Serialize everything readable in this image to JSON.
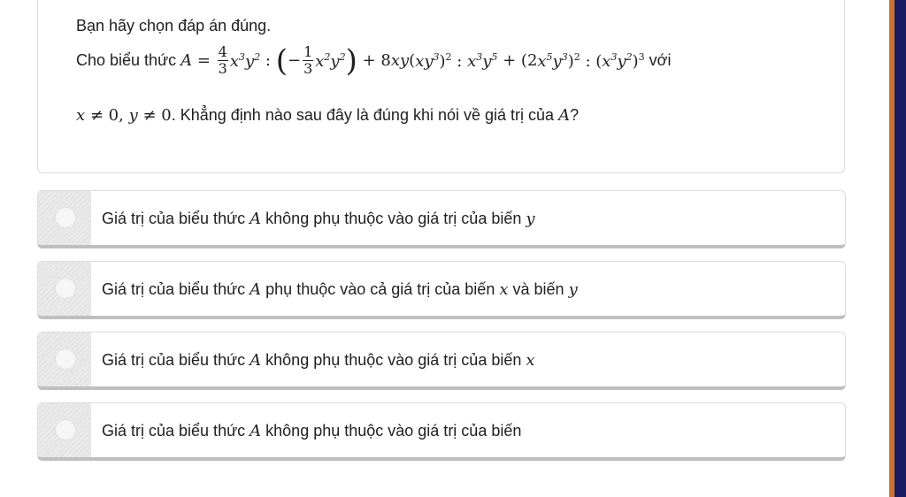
{
  "question": {
    "instruction": "Bạn hãy chọn đáp án đúng.",
    "intro": "Cho biểu thức",
    "suffix": "với",
    "condition_text": ". Khẳng định nào sau đây là đúng khi nói về giá trị của",
    "question_end": "?"
  },
  "options": [
    {
      "text_before": "Giá trị của biểu thức",
      "text_after": "không phụ thuộc vào giá trị của biến",
      "var": "y"
    },
    {
      "text_before": "Giá trị của biểu thức",
      "text_after": "phụ thuộc vào cả giá trị của biến",
      "var": "x",
      "text_after2": "và biến",
      "var2": "y"
    },
    {
      "text_before": "Giá trị của biểu thức",
      "text_after": "không phụ thuộc vào giá trị của biến",
      "var": "x"
    },
    {
      "text_before": "Giá trị của biểu thức",
      "text_after": "không phụ thuộc vào giá trị của biến"
    }
  ],
  "colors": {
    "accent_right": "#c8742c",
    "dark_right": "#1b1b63"
  }
}
